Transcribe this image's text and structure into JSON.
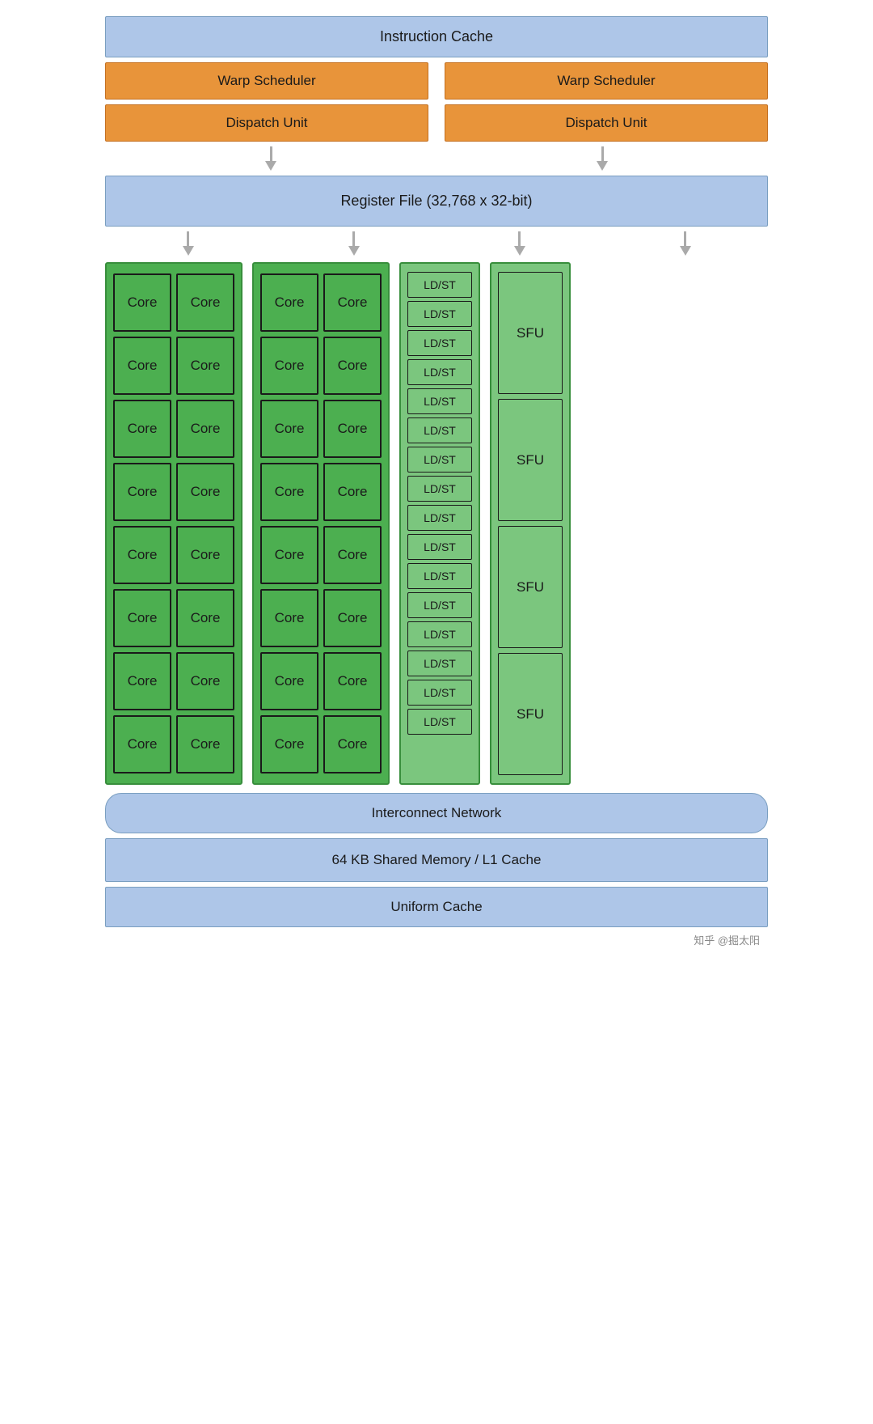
{
  "diagram": {
    "instruction_cache": "Instruction Cache",
    "warp_scheduler_1": "Warp Scheduler",
    "warp_scheduler_2": "Warp Scheduler",
    "dispatch_unit_1": "Dispatch Unit",
    "dispatch_unit_2": "Dispatch Unit",
    "register_file": "Register File (32,768 x 32-bit)",
    "core_label": "Core",
    "ldst_label": "LD/ST",
    "sfu_label": "SFU",
    "interconnect": "Interconnect Network",
    "shared_memory": "64 KB Shared Memory / L1 Cache",
    "uniform_cache": "Uniform Cache",
    "watermark": "知乎 @掘太阳",
    "core_rows": 8,
    "ldst_count": 16,
    "sfu_count": 4
  }
}
